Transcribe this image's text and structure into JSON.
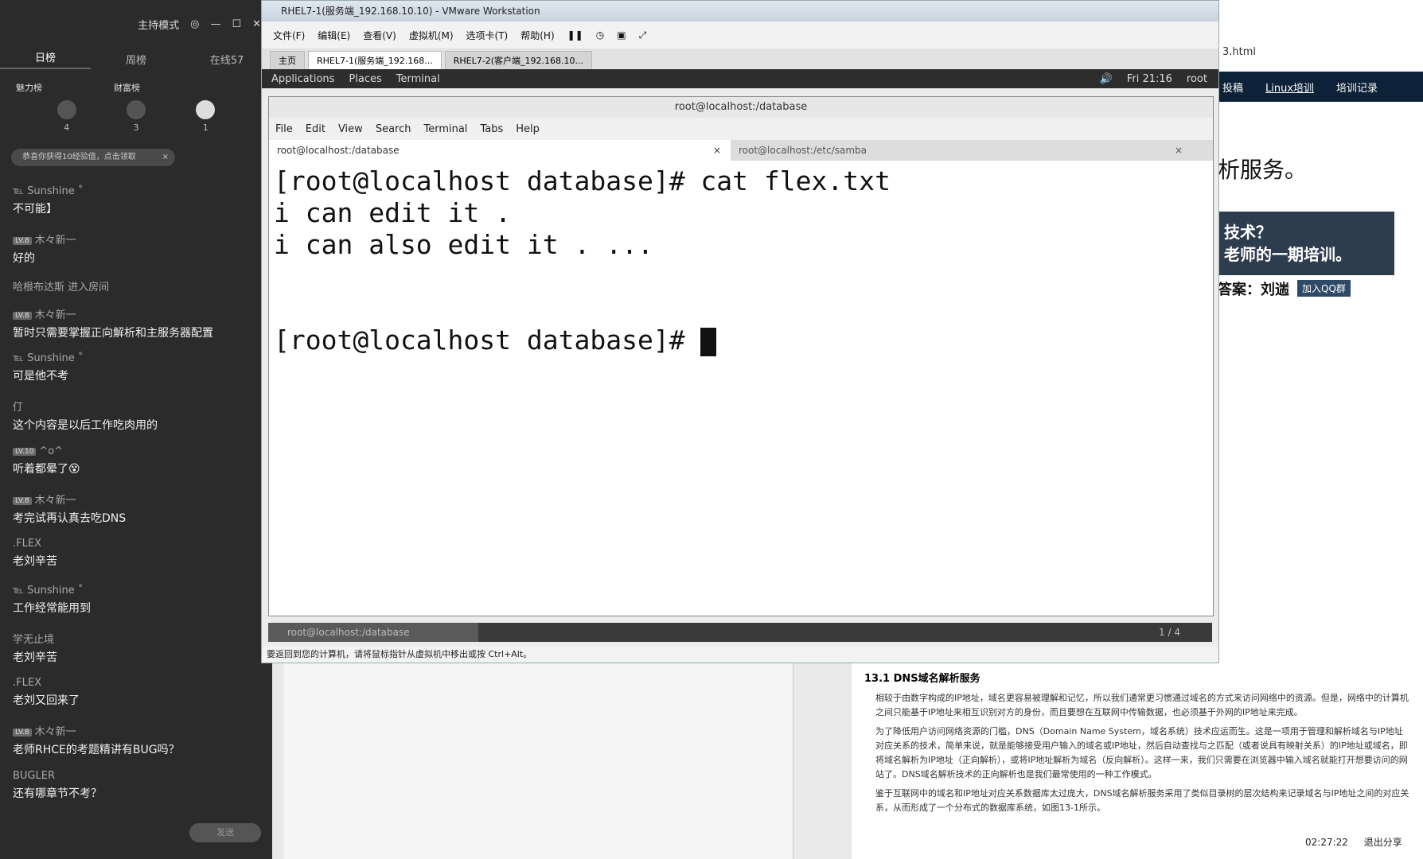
{
  "chat": {
    "host_mode": "主持模式",
    "tabs": [
      "日榜",
      "周榜",
      "在线57"
    ],
    "rank_headers": [
      "魅力榜",
      "财富榜"
    ],
    "ranks": [
      "4",
      "3",
      "1"
    ],
    "notice": "恭喜你获得10经验值，点击领取",
    "messages": [
      {
        "user": "℡ Sunshine ˚",
        "badge": "",
        "text": "不可能】"
      },
      {
        "user": "木々新一",
        "badge": "LV.8",
        "text": "好的"
      },
      {
        "user": "",
        "badge": "",
        "text": "哈根布达斯 进入房间"
      },
      {
        "user": "木々新一",
        "badge": "LV.8",
        "text": "暂时只需要掌握正向解析和主服务器配置"
      },
      {
        "user": "℡ Sunshine ˚",
        "badge": "",
        "text": "可是他不考"
      },
      {
        "user": "仃",
        "badge": "",
        "text": "这个内容是以后工作吃肉用的"
      },
      {
        "user": "^o^",
        "badge": "LV.10",
        "text": "听着都晕了😵"
      },
      {
        "user": "木々新一",
        "badge": "LV.8",
        "text": "考完试再认真去吃DNS"
      },
      {
        "user": ".FLEX",
        "badge": "",
        "text": "老刘辛苦"
      },
      {
        "user": "℡ Sunshine ˚",
        "badge": "",
        "text": "工作经常能用到"
      },
      {
        "user": "学无止境",
        "badge": "",
        "text": "老刘辛苦"
      },
      {
        "user": ".FLEX",
        "badge": "",
        "text": "老刘又回来了"
      },
      {
        "user": "木々新一",
        "badge": "LV.8",
        "text": "老师RHCE的考题精讲有BUG吗？"
      },
      {
        "user": "BUGLER",
        "badge": "",
        "text": "还有哪章节不考？"
      }
    ],
    "send": "发送"
  },
  "vmware": {
    "title": "RHEL7-1(服务端_192.168.10.10) - VMware Workstation",
    "menu": [
      "文件(F)",
      "编辑(E)",
      "查看(V)",
      "虚拟机(M)",
      "选项卡(T)",
      "帮助(H)"
    ],
    "tabs": [
      "主页",
      "RHEL7-1(服务端_192.168...",
      "RHEL7-2(客户端_192.168.10..."
    ],
    "status": "要返回到您的计算机，请将鼠标指针从虚拟机中移出或按 Ctrl+Alt。"
  },
  "gnome": {
    "apps": "Applications",
    "places": "Places",
    "terminal": "Terminal",
    "time": "Fri 21:16",
    "user": "root"
  },
  "terminal": {
    "title": "root@localhost:/database",
    "menu": [
      "File",
      "Edit",
      "View",
      "Search",
      "Terminal",
      "Tabs",
      "Help"
    ],
    "tabs": [
      "root@localhost:/database",
      "root@localhost:/etc/samba"
    ],
    "lines": [
      "[root@localhost database]# cat flex.txt",
      "i can edit it .",
      "i can also edit it . ...",
      "",
      "",
      "[root@localhost database]# "
    ],
    "taskbar_item": "root@localhost:/database",
    "page": "1 / 4"
  },
  "web": {
    "url": "3.html",
    "nav": [
      "投稿",
      "Linux培训",
      "培训记录"
    ],
    "heading": "析服务。",
    "banner": [
      "技术？",
      "老师的一期培训。"
    ],
    "answer": "答案：刘遄",
    "qq": "加入QQ群",
    "section": "13.1 DNS域名解析服务",
    "paras": [
      "相较于由数字构成的IP地址，域名更容易被理解和记忆，所以我们通常更习惯通过域名的方式来访问网络中的资源。但是，网络中的计算机之间只能基于IP地址来相互识别对方的身份，而且要想在互联网中传输数据，也必须基于外网的IP地址来完成。",
      "为了降低用户访问网络资源的门槛，DNS（Domain Name System，域名系统）技术应运而生。这是一项用于管理和解析域名与IP地址对应关系的技术，简单来说，就是能够接受用户输入的域名或IP地址，然后自动查找与之匹配（或者说具有映射关系）的IP地址或域名，即将域名解析为IP地址（正向解析），或将IP地址解析为域名（反向解析）。这样一来，我们只需要在浏览器中输入域名就能打开想要访问的网站了。DNS域名解析技术的正向解析也是我们最常使用的一种工作模式。",
      "鉴于互联网中的域名和IP地址对应关系数据库太过庞大，DNS域名解析服务采用了类似目录树的层次结构来记录域名与IP地址之间的对应关系，从而形成了一个分布式的数据库系统，如图13-1所示。"
    ],
    "clock": "02:27:22",
    "exit_share": "退出分享"
  }
}
